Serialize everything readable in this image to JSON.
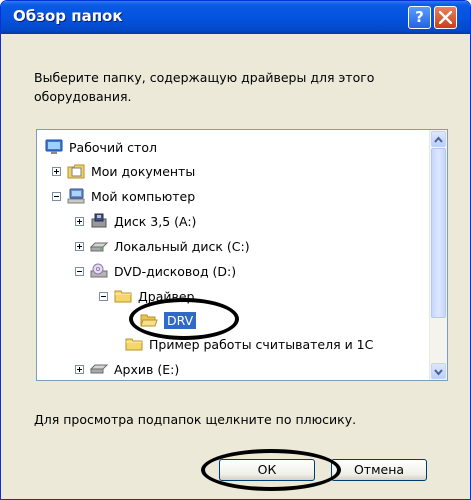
{
  "dialog": {
    "title": "Обзор папок",
    "help_label": "?",
    "instruction": "Выберите папку, содержащую драйверы для этого оборудования.",
    "hint": "Для просмотра подпапок щелкните по плюсику.",
    "ok_label": "ОК",
    "cancel_label": "Отмена"
  },
  "tree": {
    "items": [
      {
        "label": "Рабочий стол",
        "icon": "desktop-icon",
        "expander": "none"
      },
      {
        "label": "Мои документы",
        "icon": "my-documents-icon",
        "expander": "plus"
      },
      {
        "label": "Мой компьютер",
        "icon": "my-computer-icon",
        "expander": "minus"
      },
      {
        "label": "Диск 3,5 (A:)",
        "icon": "floppy-drive-icon",
        "expander": "plus"
      },
      {
        "label": "Локальный диск (C:)",
        "icon": "hard-drive-icon",
        "expander": "plus"
      },
      {
        "label": "DVD-дисковод (D:)",
        "icon": "dvd-drive-icon",
        "expander": "minus"
      },
      {
        "label": "Драйвер",
        "icon": "folder-icon",
        "expander": "minus"
      },
      {
        "label": "DRV",
        "icon": "open-folder-icon",
        "expander": "none",
        "selected": true
      },
      {
        "label": "Пример работы считывателя и 1С",
        "icon": "folder-icon",
        "expander": "none"
      },
      {
        "label": "Архив (E:)",
        "icon": "network-drive-icon",
        "expander": "plus"
      }
    ]
  },
  "colors": {
    "title_bar": "#0553df",
    "selection": "#316ac5",
    "dialog_bg": "#ece9d8",
    "annotation": "#000000"
  }
}
